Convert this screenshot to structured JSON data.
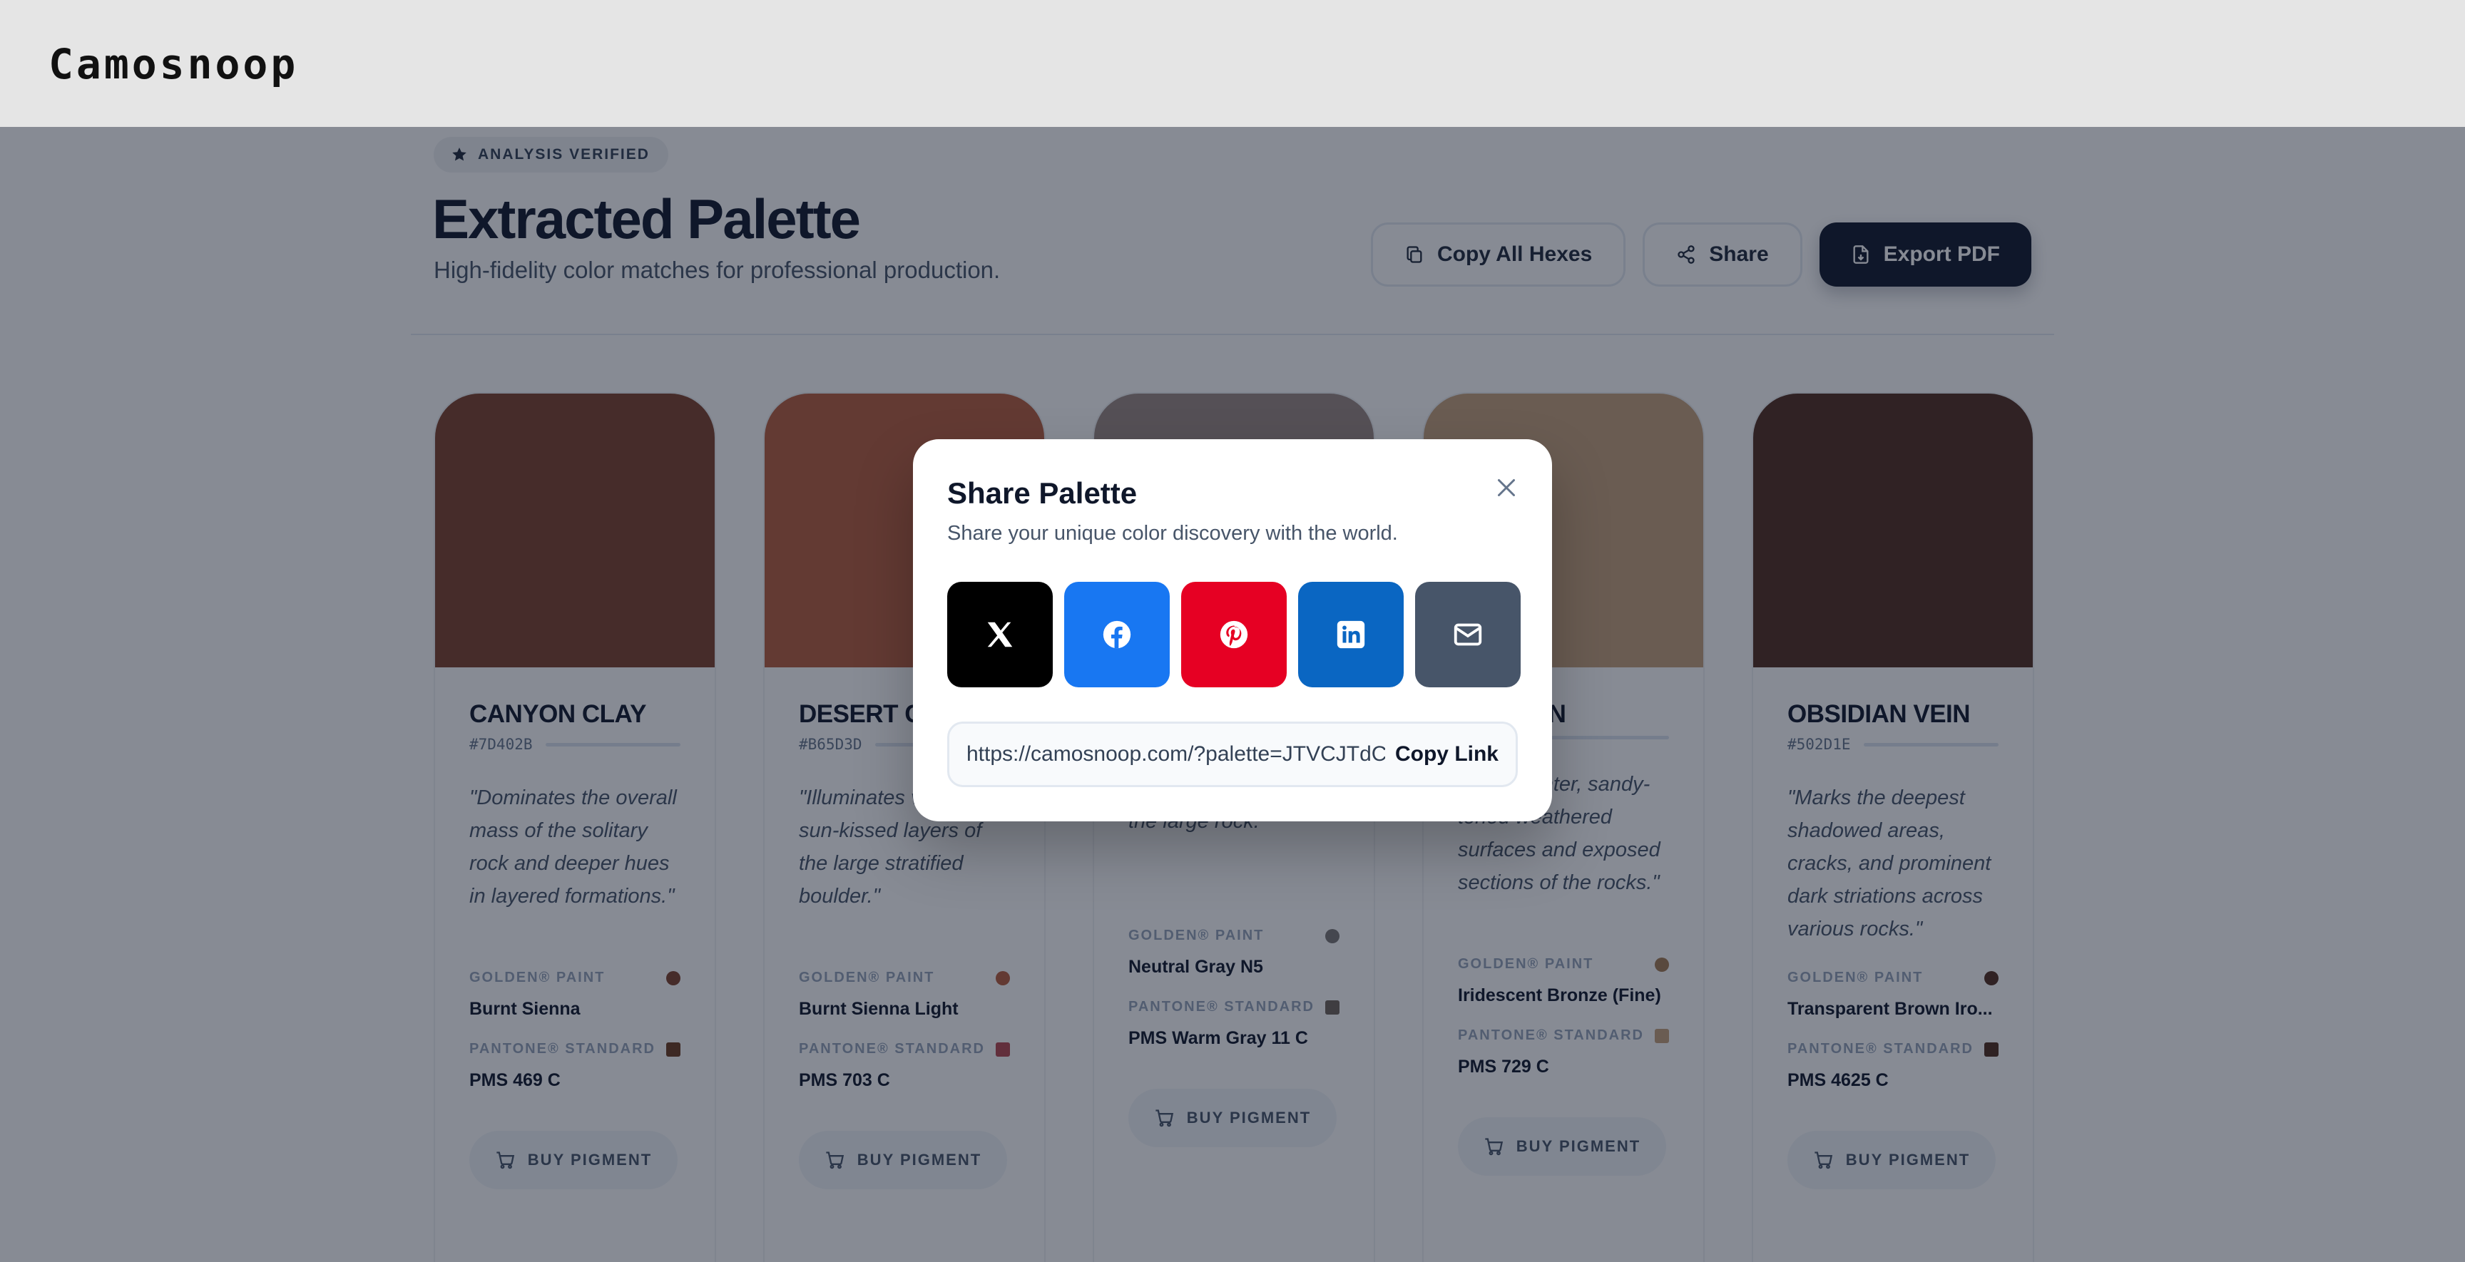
{
  "header": {
    "logo": "Camosnoop"
  },
  "page": {
    "badge": "ANALYSIS VERIFIED",
    "title": "Extracted Palette",
    "subtitle": "High-fidelity color matches for professional production.",
    "actions": {
      "copy_all": "Copy All Hexes",
      "share": "Share",
      "export": "Export PDF"
    }
  },
  "cards": [
    {
      "name": "CANYON CLAY",
      "hex": "#7D402B",
      "description": "\"Dominates the overall mass of the solitary rock and deeper hues in layered formations.\"",
      "paint_label": "GOLDEN® PAINT",
      "paint": "Burnt Sienna",
      "paint_color": "#7D402B",
      "pantone_label": "PANTONE® STANDARD",
      "pantone": "PMS 469 C",
      "pantone_color": "#6B3A1E",
      "buy_label": "BUY PIGMENT"
    },
    {
      "name": "DESERT C",
      "hex": "#B65D3D",
      "description": "\"Illuminates vibrant, sun-kissed layers of the large stratified boulder.\"",
      "paint_label": "GOLDEN® PAINT",
      "paint": "Burnt Sienna Light",
      "paint_color": "#B65D3D",
      "pantone_label": "PANTONE® STANDARD",
      "pantone": "PMS 703 C",
      "pantone_color": "#B5474F",
      "buy_label": "BUY PIGMENT"
    },
    {
      "name": "",
      "hex": "",
      "description": "cool-toned band within the intricate layers of the large rock.\"",
      "paint_label": "GOLDEN® PAINT",
      "paint": "Neutral Gray N5",
      "paint_color": "#7A7775",
      "pantone_label": "PANTONE® STANDARD",
      "pantone": "PMS Warm Gray 11 C",
      "pantone_color": "#6E6259",
      "buy_label": "BUY PIGMENT"
    },
    {
      "name": "ONE TAN",
      "hex": "",
      "description": "on the lighter, sandy-toned weathered surfaces and exposed sections of the rocks.\"",
      "paint_label": "GOLDEN® PAINT",
      "paint": "Iridescent Bronze (Fine)",
      "paint_color": "#A37A52",
      "pantone_label": "PANTONE® STANDARD",
      "pantone": "PMS 729 C",
      "pantone_color": "#C4A07A",
      "buy_label": "BUY PIGMENT"
    },
    {
      "name": "OBSIDIAN VEIN",
      "hex": "#502D1E",
      "description": "\"Marks the deepest shadowed areas, cracks, and prominent dark striations across various rocks.\"",
      "paint_label": "GOLDEN® PAINT",
      "paint": "Transparent Brown Iro...",
      "paint_color": "#502D1E",
      "pantone_label": "PANTONE® STANDARD",
      "pantone": "PMS 4625 C",
      "pantone_color": "#4F2C1D",
      "buy_label": "BUY PIGMENT"
    }
  ],
  "swatches": [
    "#7D402B",
    "#B65D3D",
    "#9A8882",
    "#C4A07A",
    "#502D1E"
  ],
  "modal": {
    "title": "Share Palette",
    "subtitle": "Share your unique color discovery with the world.",
    "socials": [
      {
        "icon": "x-icon",
        "color": "#000000"
      },
      {
        "icon": "facebook-icon",
        "color": "#1877F2"
      },
      {
        "icon": "pinterest-icon",
        "color": "#E60023"
      },
      {
        "icon": "linkedin-icon",
        "color": "#0A66C2"
      },
      {
        "icon": "email-icon",
        "color": "#475569"
      }
    ],
    "link": "https://camosnoop.com/?palette=JTVCJTdC…",
    "copy_label": "Copy Link"
  }
}
